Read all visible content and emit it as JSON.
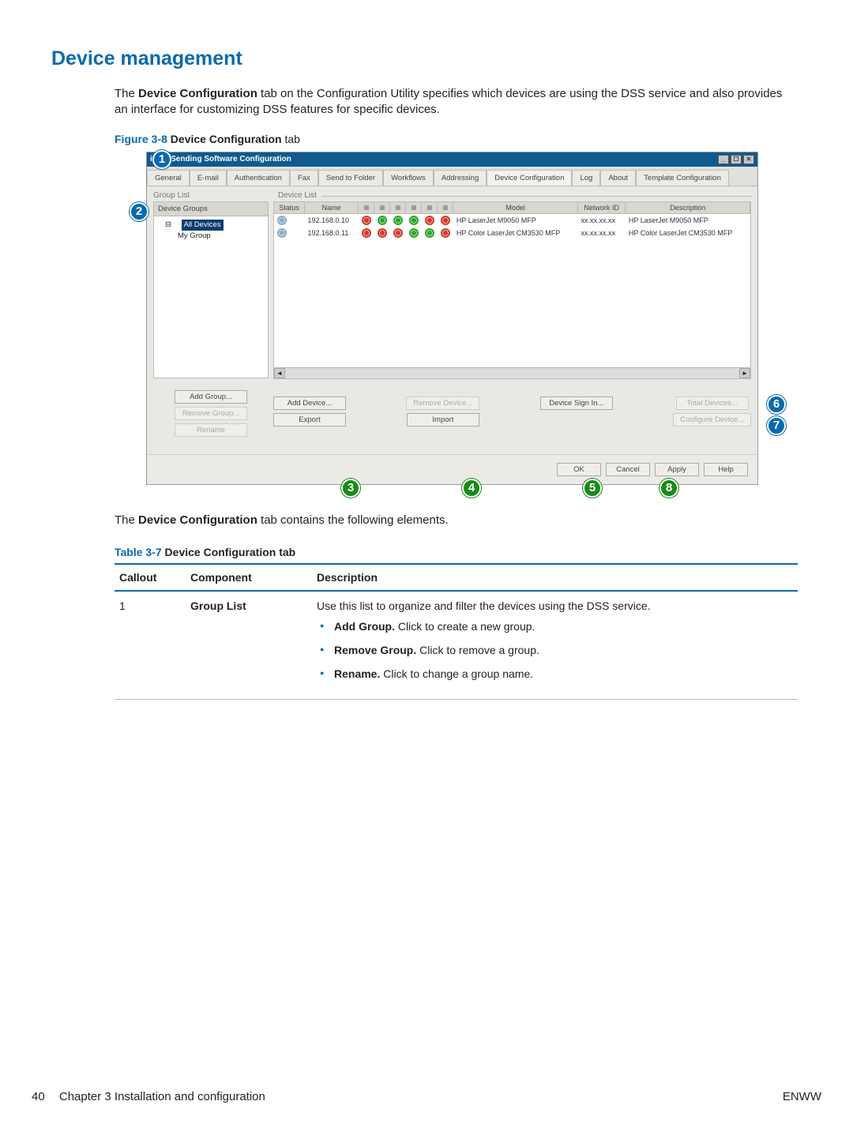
{
  "page": {
    "section_title": "Device management",
    "intro_before": "The ",
    "intro_bold": "Device Configuration",
    "intro_after": " tab on the Configuration Utility specifies which devices are using the DSS service and also provides an interface for customizing DSS features for specific devices.",
    "fig_num": "Figure 3-8",
    "fig_title": "  Device Configuration",
    "fig_suffix": " tab",
    "after_fig_before": "The ",
    "after_fig_bold": "Device Configuration",
    "after_fig_after": " tab contains the following elements.",
    "tbl_num": "Table 3-7",
    "tbl_title": "  Device Configuration tab",
    "footer_page": "40",
    "footer_chapter": "Chapter 3   Installation and configuration",
    "footer_right": "ENWW"
  },
  "callouts": {
    "1": "1",
    "2": "2",
    "3": "3",
    "4": "4",
    "5": "5",
    "6": "6",
    "7": "7",
    "8": "8"
  },
  "window": {
    "title": "igital Sending Software Configuration",
    "tabs": [
      "General",
      "E-mail",
      "Authentication",
      "Fax",
      "Send to Folder",
      "Workflows",
      "Addressing",
      "Device Configuration",
      "Log",
      "About",
      "Template Configuration"
    ],
    "group_list_label": "Group List",
    "device_list_label": "Device List",
    "tree": {
      "header": "Device Groups",
      "root": "All Devices",
      "child": "My Group"
    },
    "left_buttons": {
      "add_group": "Add Group...",
      "remove_group": "Remove Group...",
      "rename": "Rename"
    },
    "table_headers": {
      "status": "Status",
      "name": "Name",
      "model": "Model",
      "network": "Network ID",
      "desc": "Description"
    },
    "rows": [
      {
        "name": "192.168.0.10",
        "s": [
          "red",
          "green",
          "green",
          "green",
          "red",
          "red"
        ],
        "model": "HP LaserJet M9050 MFP",
        "net": "xx.xx.xx.xx",
        "desc": "HP LaserJet M9050 MFP"
      },
      {
        "name": "192.168.0.11",
        "s": [
          "red",
          "red",
          "red",
          "green",
          "green",
          "red"
        ],
        "model": "HP Color LaserJet CM3530 MFP",
        "net": "xx.xx.xx.xx",
        "desc": "HP Color LaserJet CM3530 MFP"
      }
    ],
    "right_buttons": {
      "add_device": "Add Device...",
      "export": "Export",
      "remove_device": "Remove Device...",
      "import": "Import",
      "device_sign_in": "Device Sign In...",
      "total_devices": "Total Devices...",
      "configure_device": "Configure Device..."
    },
    "dialog_buttons": {
      "ok": "OK",
      "cancel": "Cancel",
      "apply": "Apply",
      "help": "Help"
    }
  },
  "table37": {
    "headers": {
      "callout": "Callout",
      "component": "Component",
      "description": "Description"
    },
    "row1": {
      "callout": "1",
      "component": "Group List",
      "desc_line": "Use this list to organize and filter the devices using the DSS service.",
      "b1_bold": "Add Group.",
      "b1_rest": " Click to create a new group.",
      "b2_bold": "Remove Group.",
      "b2_rest": " Click to remove a group.",
      "b3_bold": "Rename.",
      "b3_rest": " Click to change a group name."
    }
  }
}
